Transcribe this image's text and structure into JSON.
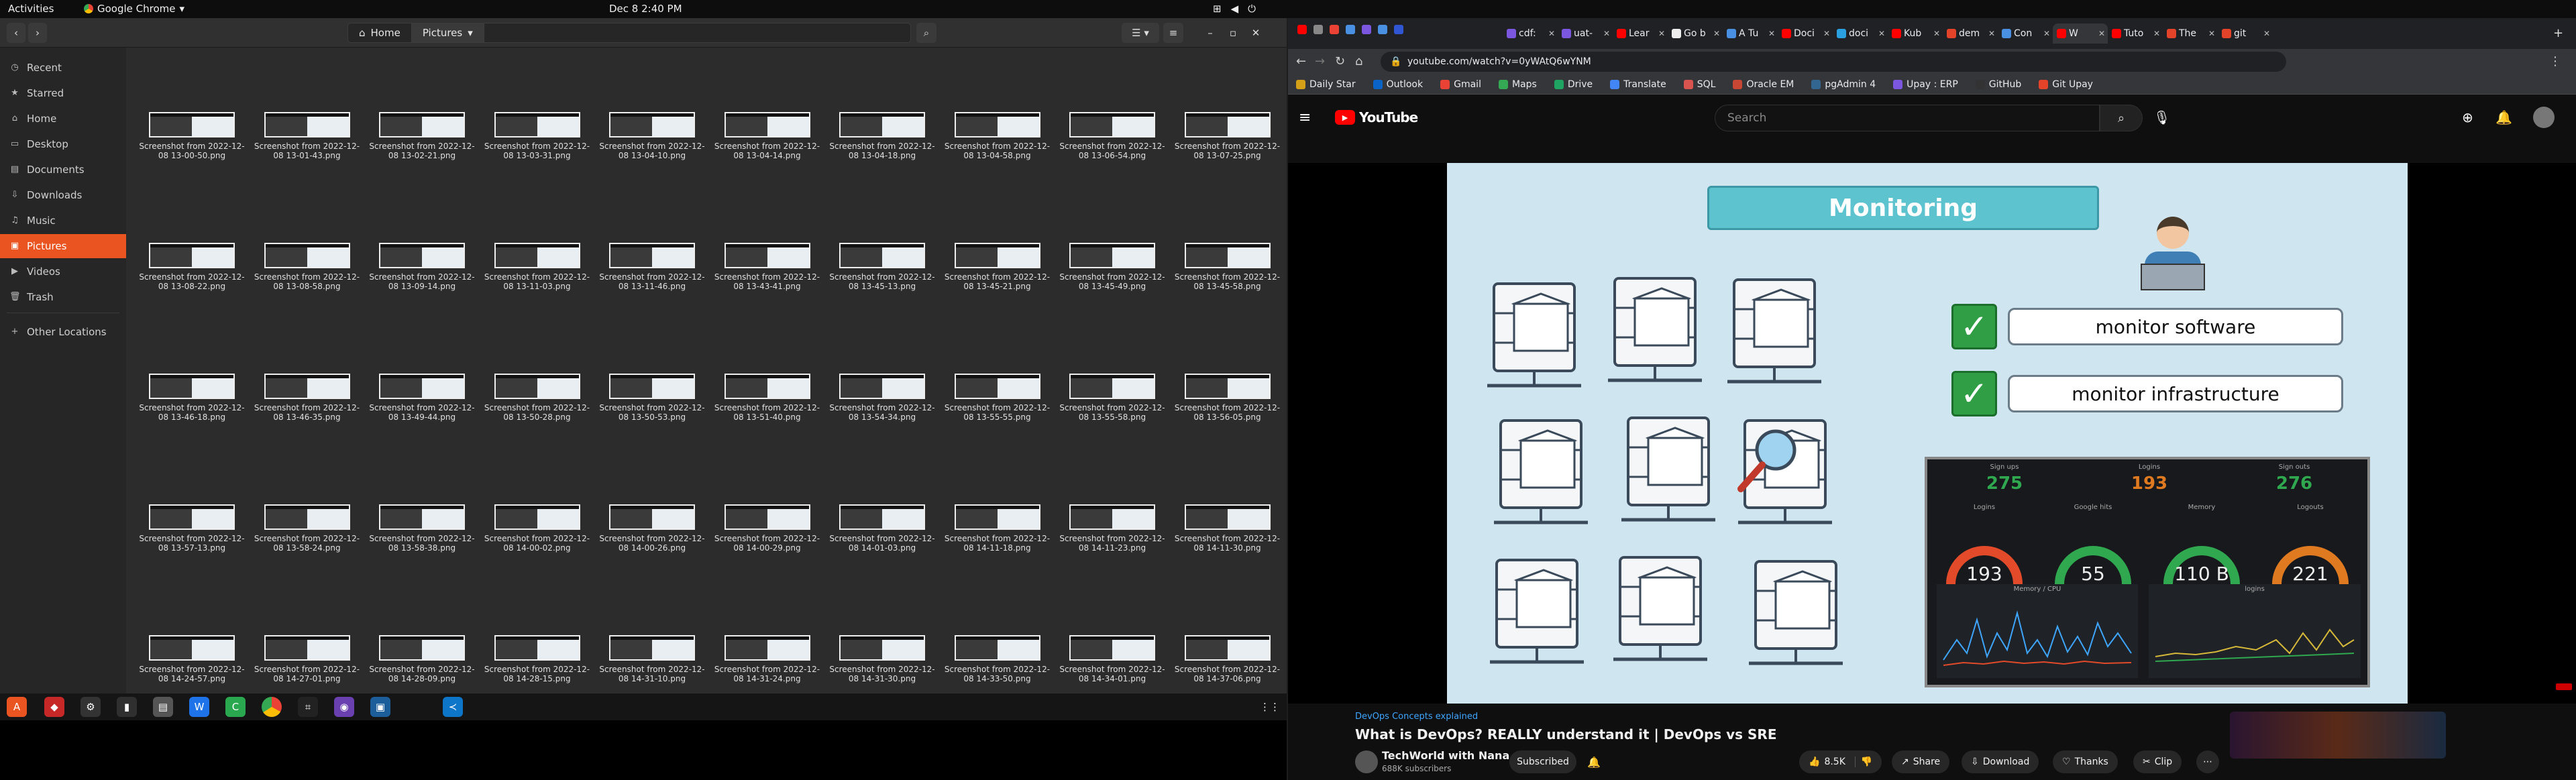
{
  "topbar": {
    "activities": "Activities",
    "app": "Google Chrome",
    "clock": "Dec 8  2:40 PM"
  },
  "files": {
    "breadcrumbs": [
      "Home",
      "Pictures"
    ],
    "sidebar": [
      {
        "label": "Recent",
        "icon": "◷"
      },
      {
        "label": "Starred",
        "icon": "★"
      },
      {
        "label": "Home",
        "icon": "⌂"
      },
      {
        "label": "Desktop",
        "icon": "▭"
      },
      {
        "label": "Documents",
        "icon": "▤"
      },
      {
        "label": "Downloads",
        "icon": "⇩"
      },
      {
        "label": "Music",
        "icon": "♫"
      },
      {
        "label": "Pictures",
        "icon": "▣"
      },
      {
        "label": "Videos",
        "icon": "▶"
      },
      {
        "label": "Trash",
        "icon": "🗑"
      },
      {
        "label": "Other Locations",
        "icon": "+"
      }
    ],
    "items": [
      "Screenshot from 2022-12-08 13-00-50.png",
      "Screenshot from 2022-12-08 13-01-43.png",
      "Screenshot from 2022-12-08 13-02-21.png",
      "Screenshot from 2022-12-08 13-03-31.png",
      "Screenshot from 2022-12-08 13-04-10.png",
      "Screenshot from 2022-12-08 13-04-14.png",
      "Screenshot from 2022-12-08 13-04-18.png",
      "Screenshot from 2022-12-08 13-04-58.png",
      "Screenshot from 2022-12-08 13-06-54.png",
      "Screenshot from 2022-12-08 13-07-25.png",
      "Screenshot from 2022-12-08 13-08-22.png",
      "Screenshot from 2022-12-08 13-08-58.png",
      "Screenshot from 2022-12-08 13-09-14.png",
      "Screenshot from 2022-12-08 13-11-03.png",
      "Screenshot from 2022-12-08 13-11-46.png",
      "Screenshot from 2022-12-08 13-43-41.png",
      "Screenshot from 2022-12-08 13-45-13.png",
      "Screenshot from 2022-12-08 13-45-21.png",
      "Screenshot from 2022-12-08 13-45-49.png",
      "Screenshot from 2022-12-08 13-45-58.png",
      "Screenshot from 2022-12-08 13-46-18.png",
      "Screenshot from 2022-12-08 13-46-35.png",
      "Screenshot from 2022-12-08 13-49-44.png",
      "Screenshot from 2022-12-08 13-50-28.png",
      "Screenshot from 2022-12-08 13-50-53.png",
      "Screenshot from 2022-12-08 13-51-40.png",
      "Screenshot from 2022-12-08 13-54-34.png",
      "Screenshot from 2022-12-08 13-55-55.png",
      "Screenshot from 2022-12-08 13-55-58.png",
      "Screenshot from 2022-12-08 13-56-05.png",
      "Screenshot from 2022-12-08 13-57-13.png",
      "Screenshot from 2022-12-08 13-58-24.png",
      "Screenshot from 2022-12-08 13-58-38.png",
      "Screenshot from 2022-12-08 14-00-02.png",
      "Screenshot from 2022-12-08 14-00-26.png",
      "Screenshot from 2022-12-08 14-00-29.png",
      "Screenshot from 2022-12-08 14-01-03.png",
      "Screenshot from 2022-12-08 14-11-18.png",
      "Screenshot from 2022-12-08 14-11-23.png",
      "Screenshot from 2022-12-08 14-11-30.png",
      "Screenshot from 2022-12-08 14-24-57.png",
      "Screenshot from 2022-12-08 14-27-01.png",
      "Screenshot from 2022-12-08 14-28-09.png",
      "Screenshot from 2022-12-08 14-28-15.png",
      "Screenshot from 2022-12-08 14-31-10.png",
      "Screenshot from 2022-12-08 14-31-24.png",
      "Screenshot from 2022-12-08 14-31-30.png",
      "Screenshot from 2022-12-08 14-33-50.png",
      "Screenshot from 2022-12-08 14-34-01.png",
      "Screenshot from 2022-12-08 14-37-06.png"
    ]
  },
  "chrome": {
    "tabs": [
      {
        "label": "cdf:",
        "color": "#7b57e0"
      },
      {
        "label": "uat-",
        "color": "#7b57e0"
      },
      {
        "label": "Lear",
        "color": "#ff0000"
      },
      {
        "label": "Go b",
        "color": "#eeeeee"
      },
      {
        "label": "A Tu",
        "color": "#4a90e2"
      },
      {
        "label": "Doci",
        "color": "#ff0000"
      },
      {
        "label": "doci",
        "color": "#2aa0e0"
      },
      {
        "label": "Kub",
        "color": "#ff0000"
      },
      {
        "label": "dem",
        "color": "#e24329"
      },
      {
        "label": "Con",
        "color": "#4a90e2"
      },
      {
        "label": "W",
        "color": "#ff0000"
      },
      {
        "label": "Tuto",
        "color": "#ff0000"
      },
      {
        "label": "The",
        "color": "#e24329"
      },
      {
        "label": "git",
        "color": "#e24329"
      }
    ],
    "url": "youtube.com/watch?v=0yWAtQ6wYNM",
    "bookmarks": [
      "Daily Star",
      "Outlook",
      "Gmail",
      "Maps",
      "Drive",
      "Translate",
      "SQL",
      "Oracle EM",
      "pgAdmin 4",
      "Upay : ERP",
      "GitHub",
      "Git Upay"
    ]
  },
  "youtube": {
    "brand": "YouTube",
    "search_placeholder": "Search",
    "slide": {
      "title": "Monitoring",
      "checks": [
        "monitor software",
        "monitor infrastructure"
      ],
      "stats": [
        {
          "label": "Sign ups",
          "value": "275"
        },
        {
          "label": "Logins",
          "value": "193"
        },
        {
          "label": "Sign outs",
          "value": "276"
        }
      ],
      "gauges": [
        {
          "label": "Logins",
          "value": "193",
          "color": "#e24a2a"
        },
        {
          "label": "Google hits",
          "value": "55",
          "color": "#2fa84f"
        },
        {
          "label": "Memory",
          "value": "110 B",
          "color": "#2fa84f"
        },
        {
          "label": "Logouts",
          "value": "221",
          "color": "#e07a20"
        }
      ],
      "panels": [
        "Memory / CPU",
        "logins"
      ]
    },
    "video_tag": "DevOps Concepts explained",
    "video_title": "What is DevOps? REALLY understand it | DevOps vs SRE",
    "channel": "TechWorld with Nana",
    "subscribers": "688K subscribers",
    "subscribed": "Subscribed",
    "actions": {
      "likes": "8.5K",
      "share": "Share",
      "download": "Download",
      "thanks": "Thanks",
      "clip": "Clip"
    }
  }
}
